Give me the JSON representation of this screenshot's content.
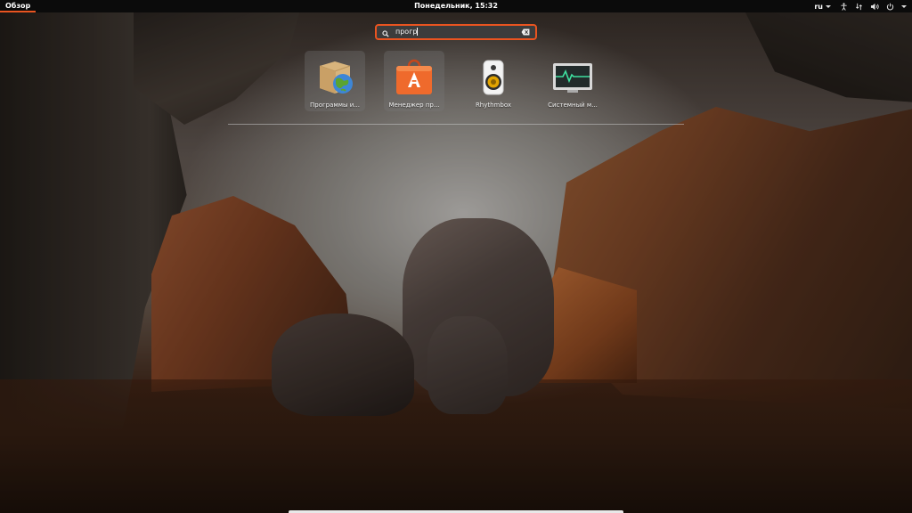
{
  "topbar": {
    "activities_label": "Обзор",
    "clock": "Понедельник, 15:32",
    "language": "ru"
  },
  "search": {
    "value": "прогр",
    "icon": "search-icon",
    "clear_icon": "clear-text-icon"
  },
  "results": [
    {
      "label": "Программы и...",
      "icon": "software-properties-icon",
      "highlighted": true
    },
    {
      "label": "Менеджер пр...",
      "icon": "ubuntu-software-icon",
      "highlighted": true
    },
    {
      "label": "Rhythmbox",
      "icon": "rhythmbox-speaker-icon",
      "highlighted": false
    },
    {
      "label": "Системный м...",
      "icon": "system-monitor-icon",
      "highlighted": false
    }
  ],
  "tray_icons": [
    "accessibility-icon",
    "network-icon",
    "volume-icon",
    "power-icon"
  ],
  "colors": {
    "accent": "#e95420",
    "topbar": "#0b0b0b",
    "search_bg": "#3c3c3c"
  }
}
